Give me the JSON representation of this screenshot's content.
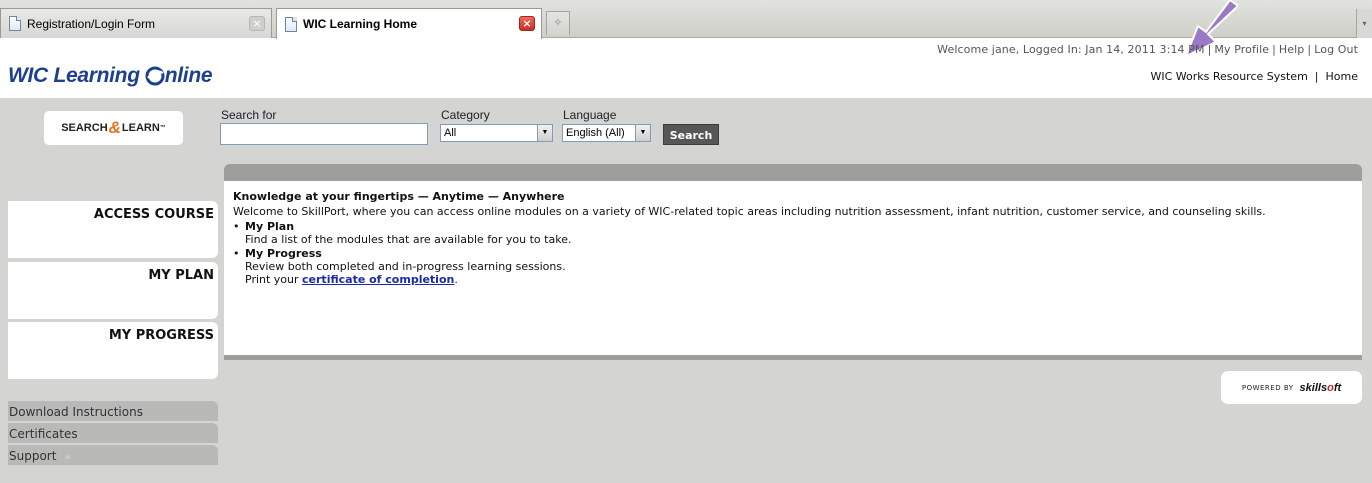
{
  "browser": {
    "tabs": [
      {
        "label": "Registration/Login Form",
        "active": false
      },
      {
        "label": "WIC Learning  Home",
        "active": true
      }
    ],
    "close_icon": "×",
    "new_tab_icon": "✧",
    "dropdown_icon": "▾"
  },
  "header": {
    "welcome": "Welcome jane, Logged In: Jan 14, 2011 3:14 PM",
    "links": [
      "My Profile",
      "Help",
      "Log Out"
    ],
    "logo_text": "WIC Learning ",
    "logo_suffix": "nline",
    "resource_link": "WIC Works Resource System",
    "home_link": "Home"
  },
  "search": {
    "logo_left": "SEARCH",
    "logo_right": "LEARN",
    "logo_tm": "™",
    "search_for_label": "Search for",
    "search_value": "",
    "category_label": "Category",
    "category_value": "All",
    "language_label": "Language",
    "language_value": "English (All)",
    "button_label": "Search"
  },
  "sidebar": {
    "nav": [
      "ACCESS COURSE",
      "MY PLAN",
      "MY PROGRESS"
    ],
    "links": [
      "Download Instructions",
      "Certificates",
      "Support"
    ],
    "support_chevron": "»"
  },
  "content": {
    "heading": "Knowledge at your fingertips — Anytime — Anywhere",
    "intro": "Welcome to SkillPort, where you can access online modules on a variety of WIC-related topic areas including nutrition assessment, infant nutrition, customer service, and counseling skills.",
    "items": [
      {
        "title": "My Plan",
        "desc": "Find a list of the modules that are available for you to take."
      },
      {
        "title": "My Progress",
        "desc": "Review both completed and in-progress learning sessions."
      }
    ],
    "print_prefix": "Print your ",
    "certificate_link": "certificate of completion",
    "print_suffix": "."
  },
  "powered_by": {
    "label": "POWERED BY",
    "brand_left": "skills",
    "brand_o": "o",
    "brand_right": "ft"
  },
  "colors": {
    "logo_blue": "#1d3f8f",
    "main_gray": "#d4d4d3",
    "link_blue": "#1a2ba8",
    "search_button": "#575757",
    "annotation_arrow": "#9b79c6"
  }
}
